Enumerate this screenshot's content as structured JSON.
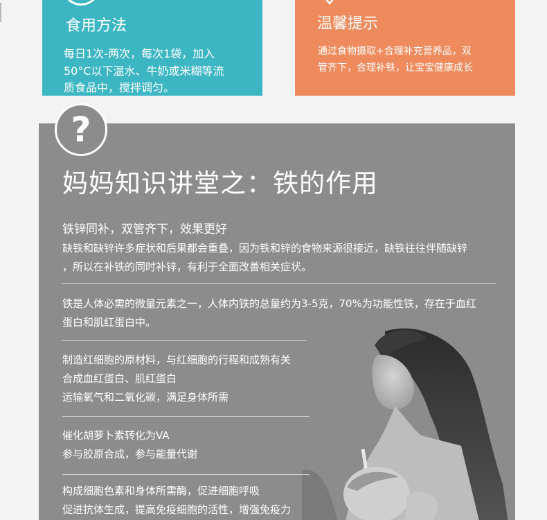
{
  "usage_card": {
    "title": "食用方法",
    "lines": [
      "每日1次-两次，每次1袋，加入",
      "50°C以下温水、牛奶或米糊等流",
      "质食品中，搅拌调匀。"
    ],
    "color": "#3db6c4"
  },
  "tips_card": {
    "title": "温馨提示",
    "lines": [
      "通过食物摄取+合理补充营养品，双",
      "管齐下，合理补铁，让宝宝健康成长"
    ],
    "color": "#ef8a5c"
  },
  "knowledge": {
    "icon": "question-mark-icon",
    "icon_glyph": "?",
    "title": "妈妈知识讲堂之：铁的作用",
    "section1": {
      "heading": "铁锌同补，双管齐下，效果更好",
      "lines": [
        "缺铁和缺锌许多症状和后果都会重叠，因为铁和锌的食物来源很接近，缺铁往往伴随缺锌",
        "，所以在补铁的同时补锌，有利于全面改善相关症状。"
      ]
    },
    "section2": {
      "lines": [
        "铁是人体必需的微量元素之一，人体内铁的总量约为3-5克，70%为功能性铁，存在于血红",
        "蛋白和肌红蛋白中。"
      ]
    },
    "section3": {
      "lines": [
        "制造红细胞的原材料，与红细胞的行程和成熟有关",
        "合成血红蛋白、肌红蛋白",
        "运输氧气和二氧化碳，满足身体所需"
      ]
    },
    "section4": {
      "lines": [
        "催化胡萝卜素转化为VA",
        "参与胶原合成，参与能量代谢"
      ]
    },
    "section5": {
      "lines": [
        "构成细胞色素和身体所需酶，促进细胞呼吸",
        "促进抗体生成，提高免疫细胞的活性，增强免疫力"
      ]
    },
    "color": "#8c8c8c"
  }
}
